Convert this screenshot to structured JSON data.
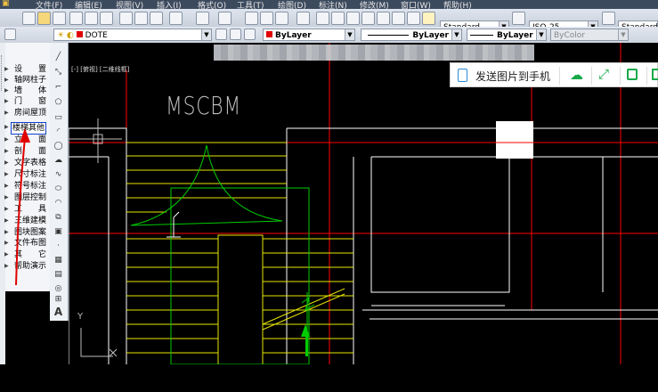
{
  "menubar": {
    "items": [
      "文件(F)",
      "编辑(E)",
      "视图(V)",
      "插入(I)",
      "格式(O)",
      "工具(T)",
      "绘图(D)",
      "标注(N)",
      "修改(M)",
      "窗口(W)",
      "帮助(H)"
    ]
  },
  "toolbar1": {
    "text_style": "Standard",
    "dim_style": "ISO-25",
    "table_style": "Standard"
  },
  "toolbar2": {
    "layer": "DOTE",
    "color": "ByLayer",
    "linetype": "ByLayer",
    "lineweight": "ByLayer",
    "plotstyle": "ByColor"
  },
  "tpanel": {
    "items": [
      "设　　置",
      "轴网柱子",
      "墙　　体",
      "门　　窗",
      "房间屋顶",
      "楼梯其他",
      "立　　面",
      "剖　　面",
      "文字表格",
      "尺寸标注",
      "符号标注",
      "图层控制",
      "工　　具",
      "三维建模",
      "图块图案",
      "文件布图",
      "其　　它",
      "帮助演示"
    ],
    "selected_index": 5
  },
  "drawing": {
    "tab_label": "[-] [俯视] [二维线框]",
    "mscbm": "MSCBM",
    "axis_y": "Y",
    "axis_x": "X"
  },
  "sendbar": {
    "label": "发送图片到手机",
    "icons": [
      "phone-send-icon",
      "cloud-icon",
      "expand-icon",
      "save-icon",
      "export-icon"
    ]
  },
  "colors": {
    "red_line": "#ff0000",
    "wall_white": "#ffffff",
    "stair_yellow": "#e6e600",
    "green": "#00cc00",
    "crosshair": "#bbbbbb"
  }
}
